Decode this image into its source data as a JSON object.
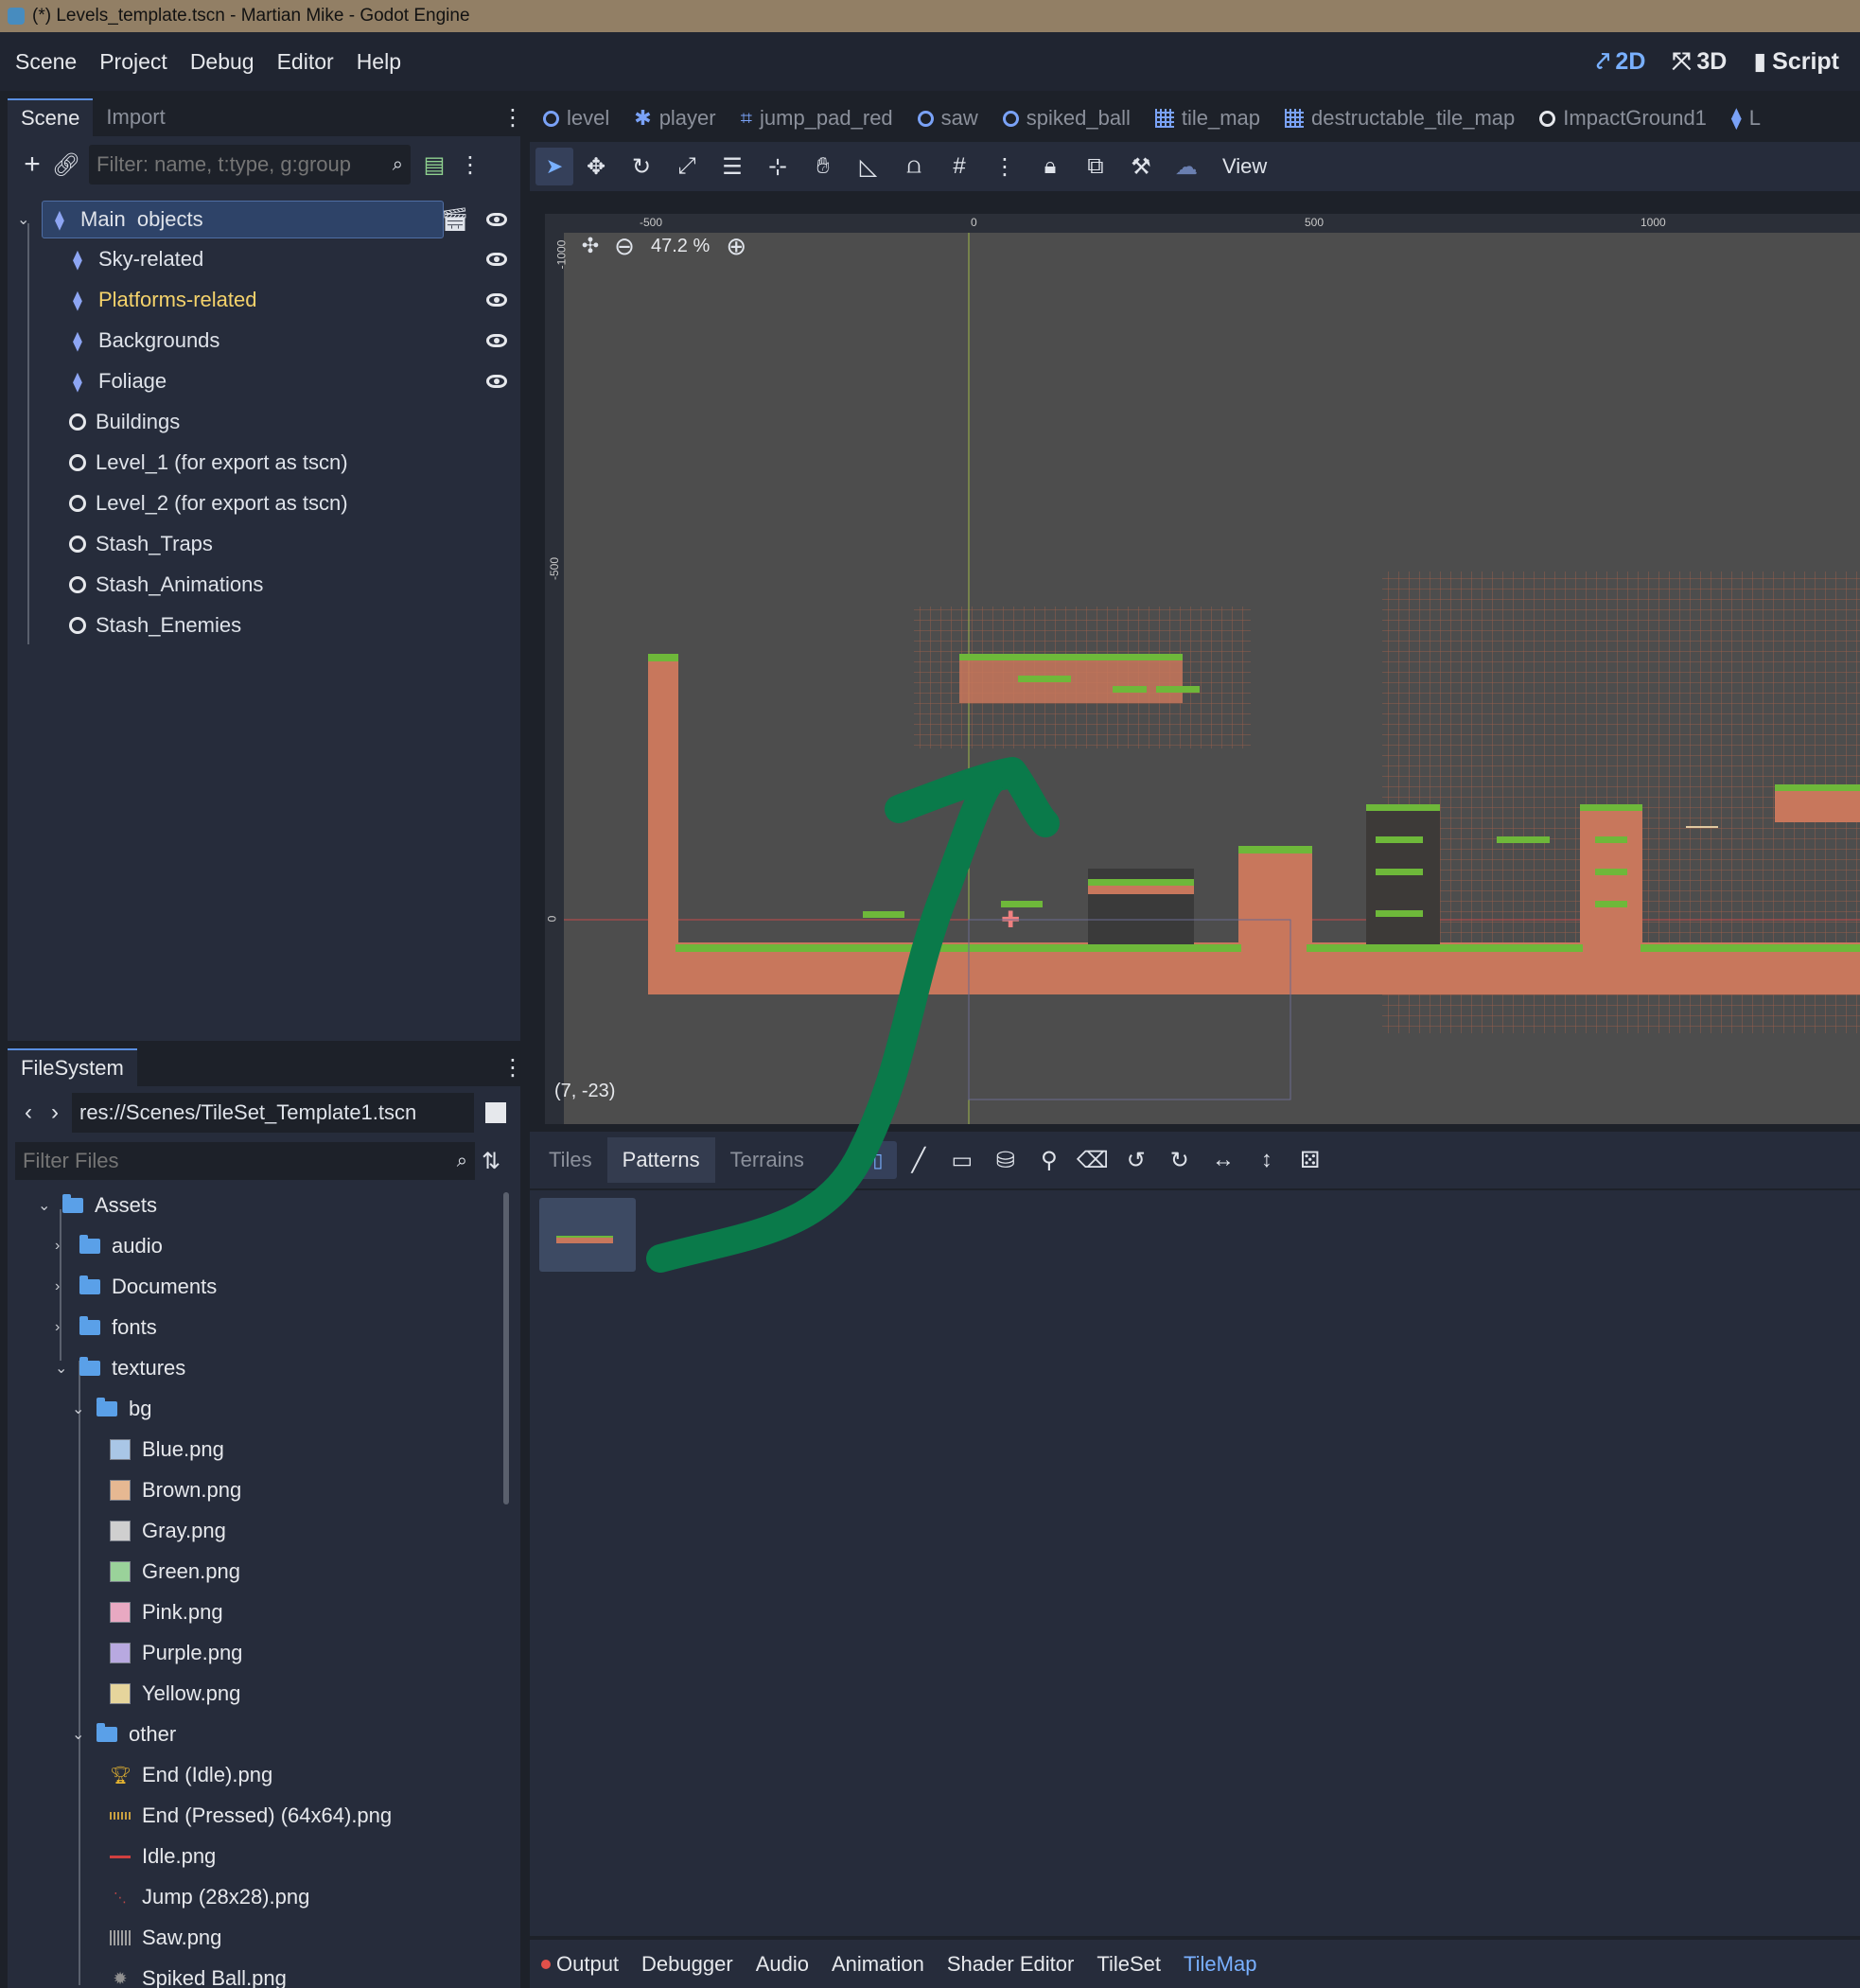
{
  "window": {
    "title": "(*) Levels_template.tscn - Martian Mike - Godot Engine"
  },
  "menu": {
    "items": [
      "Scene",
      "Project",
      "Debug",
      "Editor",
      "Help"
    ],
    "workspaces": [
      "2D",
      "3D",
      "Script"
    ],
    "active_workspace": "2D"
  },
  "scene_dock": {
    "tabs": [
      "Scene",
      "Import"
    ],
    "filter_placeholder": "Filter: name, t:type, g:group",
    "nodes": [
      {
        "label": "Main  objects",
        "type": "node2d",
        "selected": true,
        "eye": true
      },
      {
        "label": "Sky-related",
        "type": "node2d",
        "eye": true
      },
      {
        "label": "Platforms-related",
        "type": "node2d",
        "eye": true,
        "highlight": "#f5d36b"
      },
      {
        "label": "Backgrounds",
        "type": "node2d",
        "eye": true
      },
      {
        "label": "Foliage",
        "type": "node2d",
        "eye": true
      },
      {
        "label": "Buildings",
        "type": "node"
      },
      {
        "label": "Level_1 (for export as tscn)",
        "type": "node"
      },
      {
        "label": "Level_2 (for export as tscn)",
        "type": "node"
      },
      {
        "label": "Stash_Traps",
        "type": "node"
      },
      {
        "label": "Stash_Animations",
        "type": "node"
      },
      {
        "label": "Stash_Enemies",
        "type": "node"
      }
    ]
  },
  "filesystem_dock": {
    "tab": "FileSystem",
    "path": "res://Scenes/TileSet_Template1.tscn",
    "filter_placeholder": "Filter Files",
    "items": [
      {
        "label": "Assets",
        "kind": "folder",
        "depth": 0,
        "open": true
      },
      {
        "label": "audio",
        "kind": "folder",
        "depth": 1,
        "open": false
      },
      {
        "label": "Documents",
        "kind": "folder",
        "depth": 1,
        "open": false
      },
      {
        "label": "fonts",
        "kind": "folder",
        "depth": 1,
        "open": false
      },
      {
        "label": "textures",
        "kind": "folder",
        "depth": 1,
        "open": true
      },
      {
        "label": "bg",
        "kind": "folder",
        "depth": 2,
        "open": true
      },
      {
        "label": "Blue.png",
        "kind": "file",
        "depth": 3,
        "color": "#a9c6e6"
      },
      {
        "label": "Brown.png",
        "kind": "file",
        "depth": 3,
        "color": "#e6b892"
      },
      {
        "label": "Gray.png",
        "kind": "file",
        "depth": 3,
        "color": "#cfcfcf"
      },
      {
        "label": "Green.png",
        "kind": "file",
        "depth": 3,
        "color": "#9ad29a"
      },
      {
        "label": "Pink.png",
        "kind": "file",
        "depth": 3,
        "color": "#e8a9c2"
      },
      {
        "label": "Purple.png",
        "kind": "file",
        "depth": 3,
        "color": "#b8a9e0"
      },
      {
        "label": "Yellow.png",
        "kind": "file",
        "depth": 3,
        "color": "#e6d59c"
      },
      {
        "label": "other",
        "kind": "folder",
        "depth": 2,
        "open": true
      },
      {
        "label": "End (Idle).png",
        "kind": "file",
        "depth": 3,
        "color": "#e0b030"
      },
      {
        "label": "End (Pressed) (64x64).png",
        "kind": "file",
        "depth": 3,
        "color": "#c8a040"
      },
      {
        "label": "Idle.png",
        "kind": "file",
        "depth": 3,
        "color": "#d04040"
      },
      {
        "label": "Jump (28x28).png",
        "kind": "file",
        "depth": 3,
        "color": "#c04848"
      },
      {
        "label": "Saw.png",
        "kind": "file",
        "depth": 3,
        "color": "#a0a0a0"
      },
      {
        "label": "Spiked Ball.png",
        "kind": "file",
        "depth": 3,
        "color": "#909090"
      }
    ]
  },
  "editor_tabs": [
    "level",
    "player",
    "jump_pad_red",
    "saw",
    "spiked_ball",
    "tile_map",
    "destructable_tile_map",
    "ImpactGround1",
    "L"
  ],
  "toolbar": {
    "view_label": "View"
  },
  "viewport": {
    "zoom": "47.2 %",
    "cursor_coords": "(7, -23)",
    "ruler_x": [
      "-500",
      "0",
      "500",
      "1000"
    ],
    "ruler_y": [
      "-1000",
      "-500",
      "0"
    ]
  },
  "tilemap_panel": {
    "tabs": [
      "Tiles",
      "Patterns",
      "Terrains"
    ],
    "active_tab": "Patterns"
  },
  "bottom_bar": {
    "tabs": [
      "Output",
      "Debugger",
      "Audio",
      "Animation",
      "Shader Editor",
      "TileSet",
      "TileMap"
    ],
    "active": "TileMap"
  },
  "colors": {
    "accent": "#79b0ff",
    "annotation_arrow": "#0a7a4a",
    "terrain": "#c8775c",
    "grass": "#6eb83a"
  }
}
